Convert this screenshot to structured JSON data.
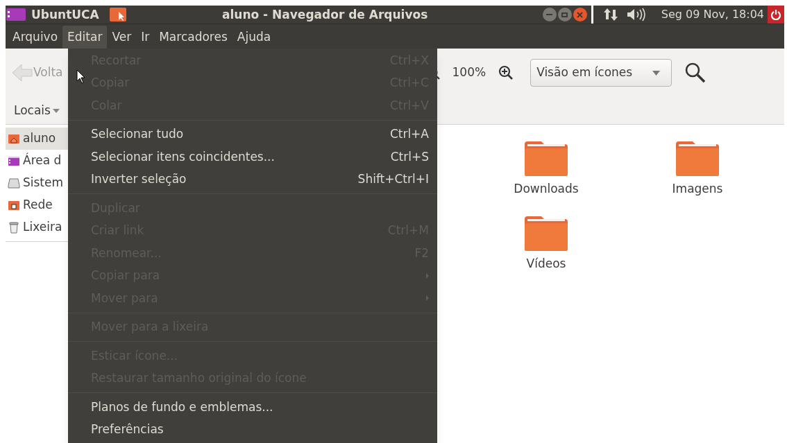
{
  "top_panel": {
    "app_name": "UbuntUCA",
    "window_title": "aluno - Navegador de Arquivos",
    "clock": "Seg 09 Nov, 18:04"
  },
  "menubar": [
    {
      "label": "Arquivo",
      "selected": false
    },
    {
      "label": "Editar",
      "selected": true
    },
    {
      "label": "Ver",
      "selected": false
    },
    {
      "label": "Ir",
      "selected": false
    },
    {
      "label": "Marcadores",
      "selected": false
    },
    {
      "label": "Ajuda",
      "selected": false
    }
  ],
  "toolbar": {
    "back_label": "Volta",
    "zoom": "100%",
    "view_select": "Visão em ícones"
  },
  "side_pane_label": "Locais",
  "sidebar": [
    {
      "label": "aluno",
      "kind": "home",
      "selected": true
    },
    {
      "label": "Área d",
      "kind": "desktop",
      "selected": false
    },
    {
      "label": "Sistem",
      "kind": "drive",
      "selected": false
    },
    {
      "label": "Rede",
      "kind": "network",
      "selected": false
    },
    {
      "label": "Lixeira",
      "kind": "trash",
      "selected": false
    }
  ],
  "files": [
    {
      "name": "Downloads"
    },
    {
      "name": "Imagens"
    },
    {
      "name": "Vídeos"
    }
  ],
  "edit_menu": [
    {
      "kind": "item",
      "label": "Recortar",
      "shortcut": "Ctrl+X",
      "disabled": true,
      "submenu": false
    },
    {
      "kind": "item",
      "label": "Copiar",
      "shortcut": "Ctrl+C",
      "disabled": true,
      "submenu": false
    },
    {
      "kind": "item",
      "label": "Colar",
      "shortcut": "Ctrl+V",
      "disabled": true,
      "submenu": false
    },
    {
      "kind": "separator"
    },
    {
      "kind": "item",
      "label": "Selecionar tudo",
      "shortcut": "Ctrl+A",
      "disabled": false,
      "submenu": false
    },
    {
      "kind": "item",
      "label": "Selecionar itens coincidentes...",
      "shortcut": "Ctrl+S",
      "disabled": false,
      "submenu": false
    },
    {
      "kind": "item",
      "label": "Inverter seleção",
      "shortcut": "Shift+Ctrl+I",
      "disabled": false,
      "submenu": false
    },
    {
      "kind": "separator"
    },
    {
      "kind": "item",
      "label": "Duplicar",
      "disabled": true,
      "submenu": false
    },
    {
      "kind": "item",
      "label": "Criar link",
      "shortcut": "Ctrl+M",
      "disabled": true,
      "submenu": false
    },
    {
      "kind": "item",
      "label": "Renomear...",
      "shortcut": "F2",
      "disabled": true,
      "submenu": false
    },
    {
      "kind": "item",
      "label": "Copiar para",
      "disabled": true,
      "submenu": true
    },
    {
      "kind": "item",
      "label": "Mover para",
      "disabled": true,
      "submenu": true
    },
    {
      "kind": "separator"
    },
    {
      "kind": "item",
      "label": "Mover para a lixeira",
      "disabled": true,
      "submenu": false
    },
    {
      "kind": "separator"
    },
    {
      "kind": "item",
      "label": "Esticar ícone...",
      "disabled": true,
      "submenu": false
    },
    {
      "kind": "item",
      "label": "Restaurar tamanho original do ícone",
      "disabled": true,
      "submenu": false
    },
    {
      "kind": "separator"
    },
    {
      "kind": "item",
      "label": "Planos de fundo e emblemas...",
      "disabled": false,
      "submenu": false
    },
    {
      "kind": "item",
      "label": "Preferências",
      "disabled": false,
      "submenu": false
    }
  ]
}
